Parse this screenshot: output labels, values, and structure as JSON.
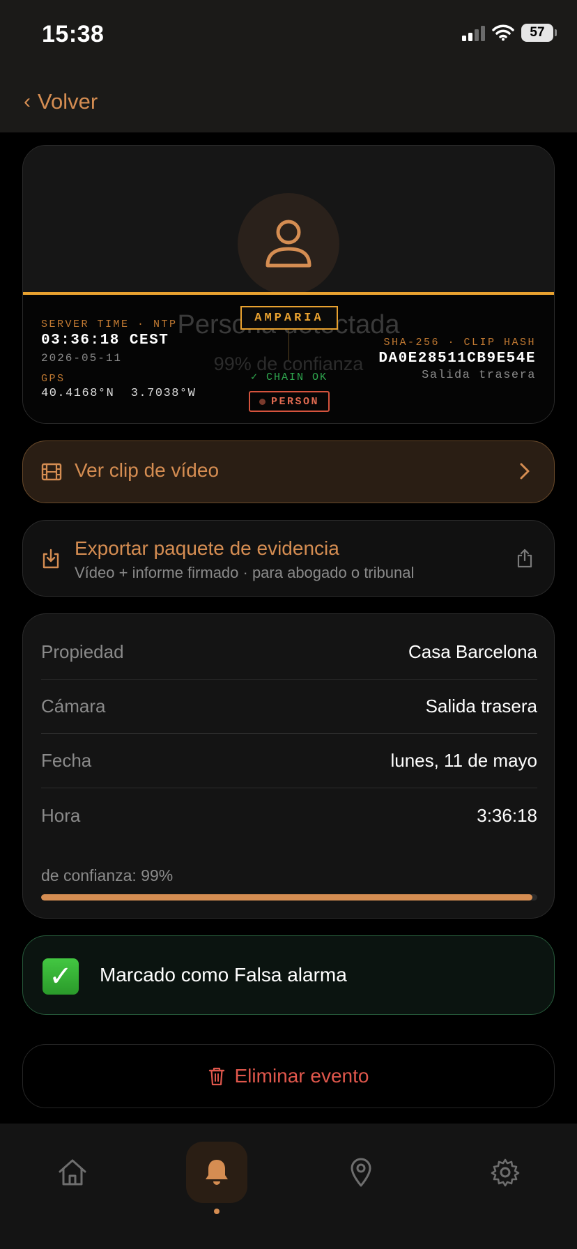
{
  "status_bar": {
    "time": "15:38",
    "battery": "57"
  },
  "nav": {
    "back_label": "Volver"
  },
  "hero": {
    "ghost_title": "Persona detectada",
    "ghost_subtitle": "99% de confianza",
    "server_time_label": "SERVER TIME · NTP",
    "server_time": "03:36:18 CEST",
    "date": "2026-05-11",
    "gps_label": "GPS",
    "gps_value": "40.4168°N  3.7038°W",
    "brand": "AMPARIA",
    "chain_status": "✓ CHAIN OK",
    "tag": "PERSON",
    "hash_label": "SHA-256 · CLIP HASH",
    "hash_value": "DA0E28511CB9E54E",
    "camera_label": "Salida trasera",
    "accent_color": "#e9a230"
  },
  "actions": {
    "clip_label": "Ver clip de vídeo",
    "export_label": "Exportar paquete de evidencia",
    "export_sub": "Vídeo + informe firmado · para abogado o tribunal"
  },
  "details": {
    "rows": [
      {
        "key": "Propiedad",
        "value": "Casa Barcelona"
      },
      {
        "key": "Cámara",
        "value": "Salida trasera"
      },
      {
        "key": "Fecha",
        "value": "lunes, 11 de mayo"
      },
      {
        "key": "Hora",
        "value": "3:36:18"
      }
    ],
    "confidence_label": "de confianza: 99%",
    "confidence": 0.99
  },
  "false_alarm": {
    "label": "Marcado como Falsa alarma",
    "icon": "check-mark-icon"
  },
  "delete": {
    "label": "Eliminar evento",
    "color": "#e0574c"
  },
  "tabbar": {
    "tabs": [
      {
        "icon": "home-icon",
        "active": false
      },
      {
        "icon": "bell-icon",
        "active": true
      },
      {
        "icon": "location-pin-icon",
        "active": false
      },
      {
        "icon": "gear-icon",
        "active": false
      }
    ]
  }
}
